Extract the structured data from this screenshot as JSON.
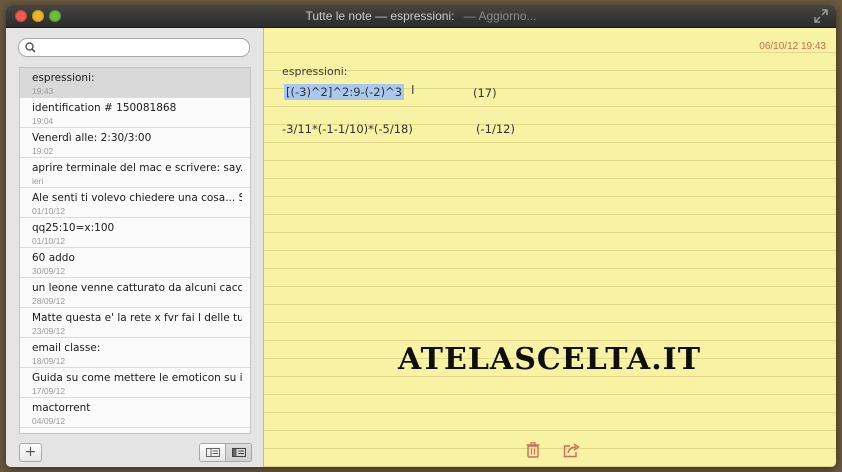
{
  "window": {
    "title": "Tutte le note — espressioni:",
    "status": "— Aggiorno..."
  },
  "search": {
    "placeholder": "",
    "value": ""
  },
  "notes": [
    {
      "title": "espressioni:",
      "date": "19:43",
      "selected": true
    },
    {
      "title": "identification # 150081868",
      "date": "19:04"
    },
    {
      "title": "Venerdì alle: 2:30/3:00",
      "date": "19:02"
    },
    {
      "title": "aprire terminale del mac e scrivere:       say...",
      "date": "ieri"
    },
    {
      "title": "Ale senti ti volevo chiedere una cosa... Se...",
      "date": "01/10/12"
    },
    {
      "title": "qq25:10=x:100",
      "date": "01/10/12"
    },
    {
      "title": "60 addo",
      "date": "30/09/12"
    },
    {
      "title": "un leone venne catturato da alcuni cacciat...",
      "date": "28/09/12"
    },
    {
      "title": "Matte questa e' la rete x fvr fai l delle tue m...",
      "date": "23/09/12"
    },
    {
      "title": "email classe:",
      "date": "18/09/12"
    },
    {
      "title": "Guida su come mettere le emoticon su iPhone",
      "date": "17/09/12"
    },
    {
      "title": "mactorrent",
      "date": "04/09/12"
    }
  ],
  "sidebar_bottom": {
    "add_label": "+"
  },
  "note": {
    "date": "06/10/12 19:43",
    "heading": "espressioni:",
    "line1_expr": "[(-3)^2]^2:9-(-2)^3",
    "line1_result": "(17)",
    "line2_expr": "-3/11*(-1-1/10)*(-5/18)",
    "line2_result": "(-1/12)"
  },
  "watermark": "ATELASCELTA.IT",
  "colors": {
    "paper": "#f8f3a4",
    "paper_line": "#e2d88a",
    "date_red": "#c96a54",
    "selection": "#a9c7ef"
  }
}
